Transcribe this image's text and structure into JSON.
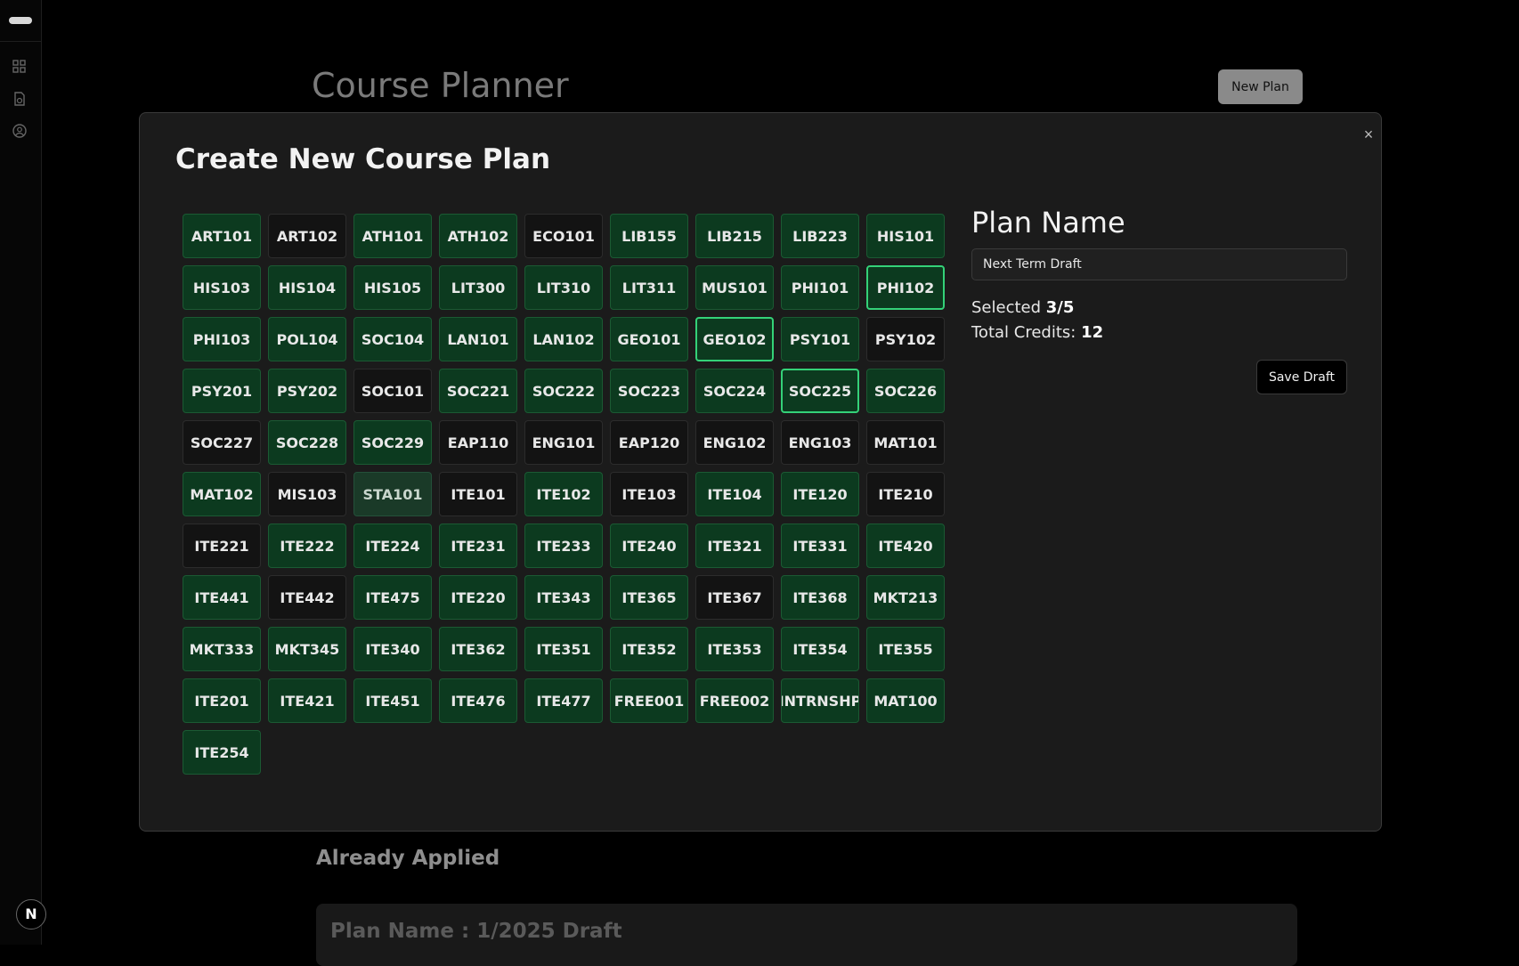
{
  "sidebar": {
    "icons": [
      "grid-icon",
      "document-icon",
      "user-circle-icon"
    ],
    "avatar_letter": "N"
  },
  "background": {
    "title": "Course Planner",
    "new_plan_label": "New Plan",
    "section_title": "Already Applied",
    "card_title": "Plan Name : 1/2025 Draft"
  },
  "modal": {
    "title": "Create New Course Plan",
    "close_icon": "×",
    "plan_name_label": "Plan Name",
    "plan_name_value": "Next Term Draft",
    "selected_label": "Selected",
    "selected_value": "3/5",
    "credits_label": "Total Credits:",
    "credits_value": "12",
    "save_label": "Save Draft"
  },
  "courses": [
    {
      "code": "ART101",
      "state": "completed"
    },
    {
      "code": "ART102",
      "state": "available"
    },
    {
      "code": "ATH101",
      "state": "completed"
    },
    {
      "code": "ATH102",
      "state": "completed"
    },
    {
      "code": "ECO101",
      "state": "available"
    },
    {
      "code": "LIB155",
      "state": "completed"
    },
    {
      "code": "LIB215",
      "state": "completed"
    },
    {
      "code": "LIB223",
      "state": "completed"
    },
    {
      "code": "HIS101",
      "state": "completed"
    },
    {
      "code": "HIS103",
      "state": "completed"
    },
    {
      "code": "HIS104",
      "state": "completed"
    },
    {
      "code": "HIS105",
      "state": "completed"
    },
    {
      "code": "LIT300",
      "state": "completed"
    },
    {
      "code": "LIT310",
      "state": "completed"
    },
    {
      "code": "LIT311",
      "state": "completed"
    },
    {
      "code": "MUS101",
      "state": "completed"
    },
    {
      "code": "PHI101",
      "state": "completed"
    },
    {
      "code": "PHI102",
      "state": "selected"
    },
    {
      "code": "PHI103",
      "state": "completed"
    },
    {
      "code": "POL104",
      "state": "completed"
    },
    {
      "code": "SOC104",
      "state": "completed"
    },
    {
      "code": "LAN101",
      "state": "completed"
    },
    {
      "code": "LAN102",
      "state": "completed"
    },
    {
      "code": "GEO101",
      "state": "completed"
    },
    {
      "code": "GEO102",
      "state": "selected"
    },
    {
      "code": "PSY101",
      "state": "completed"
    },
    {
      "code": "PSY102",
      "state": "available"
    },
    {
      "code": "PSY201",
      "state": "completed"
    },
    {
      "code": "PSY202",
      "state": "completed"
    },
    {
      "code": "SOC101",
      "state": "available"
    },
    {
      "code": "SOC221",
      "state": "completed"
    },
    {
      "code": "SOC222",
      "state": "completed"
    },
    {
      "code": "SOC223",
      "state": "completed"
    },
    {
      "code": "SOC224",
      "state": "completed"
    },
    {
      "code": "SOC225",
      "state": "selected"
    },
    {
      "code": "SOC226",
      "state": "completed"
    },
    {
      "code": "SOC227",
      "state": "available"
    },
    {
      "code": "SOC228",
      "state": "completed"
    },
    {
      "code": "SOC229",
      "state": "completed"
    },
    {
      "code": "EAP110",
      "state": "available"
    },
    {
      "code": "ENG101",
      "state": "available"
    },
    {
      "code": "EAP120",
      "state": "available"
    },
    {
      "code": "ENG102",
      "state": "available"
    },
    {
      "code": "ENG103",
      "state": "available"
    },
    {
      "code": "MAT101",
      "state": "available"
    },
    {
      "code": "MAT102",
      "state": "completed"
    },
    {
      "code": "MIS103",
      "state": "available"
    },
    {
      "code": "STA101",
      "state": "disabled"
    },
    {
      "code": "ITE101",
      "state": "available"
    },
    {
      "code": "ITE102",
      "state": "completed"
    },
    {
      "code": "ITE103",
      "state": "available"
    },
    {
      "code": "ITE104",
      "state": "completed"
    },
    {
      "code": "ITE120",
      "state": "completed"
    },
    {
      "code": "ITE210",
      "state": "available"
    },
    {
      "code": "ITE221",
      "state": "available"
    },
    {
      "code": "ITE222",
      "state": "completed"
    },
    {
      "code": "ITE224",
      "state": "completed"
    },
    {
      "code": "ITE231",
      "state": "completed"
    },
    {
      "code": "ITE233",
      "state": "completed"
    },
    {
      "code": "ITE240",
      "state": "completed"
    },
    {
      "code": "ITE321",
      "state": "completed"
    },
    {
      "code": "ITE331",
      "state": "completed"
    },
    {
      "code": "ITE420",
      "state": "completed"
    },
    {
      "code": "ITE441",
      "state": "completed"
    },
    {
      "code": "ITE442",
      "state": "available"
    },
    {
      "code": "ITE475",
      "state": "completed"
    },
    {
      "code": "ITE220",
      "state": "completed"
    },
    {
      "code": "ITE343",
      "state": "completed"
    },
    {
      "code": "ITE365",
      "state": "completed"
    },
    {
      "code": "ITE367",
      "state": "available"
    },
    {
      "code": "ITE368",
      "state": "completed"
    },
    {
      "code": "MKT213",
      "state": "completed"
    },
    {
      "code": "MKT333",
      "state": "completed"
    },
    {
      "code": "MKT345",
      "state": "completed"
    },
    {
      "code": "ITE340",
      "state": "completed"
    },
    {
      "code": "ITE362",
      "state": "completed"
    },
    {
      "code": "ITE351",
      "state": "completed"
    },
    {
      "code": "ITE352",
      "state": "completed"
    },
    {
      "code": "ITE353",
      "state": "completed"
    },
    {
      "code": "ITE354",
      "state": "completed"
    },
    {
      "code": "ITE355",
      "state": "completed"
    },
    {
      "code": "ITE201",
      "state": "completed"
    },
    {
      "code": "ITE421",
      "state": "completed"
    },
    {
      "code": "ITE451",
      "state": "completed"
    },
    {
      "code": "ITE476",
      "state": "completed"
    },
    {
      "code": "ITE477",
      "state": "completed"
    },
    {
      "code": "FREE001",
      "state": "completed"
    },
    {
      "code": "FREE002",
      "state": "completed"
    },
    {
      "code": "INTRNSHP",
      "state": "completed"
    },
    {
      "code": "MAT100",
      "state": "completed"
    },
    {
      "code": "ITE254",
      "state": "completed"
    }
  ],
  "colors": {
    "completed_bg": "#0c3a1f",
    "selected_border": "#34d178",
    "modal_bg": "#1b1b1b"
  }
}
